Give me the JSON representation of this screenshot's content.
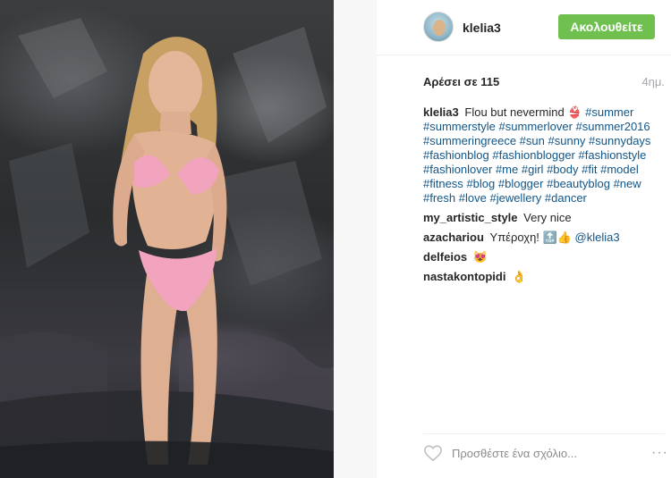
{
  "post": {
    "username": "klelia3",
    "follow_label": "Ακολουθείτε",
    "likes_label": "Αρέσει σε 115",
    "time_ago": "4ημ."
  },
  "caption": {
    "author": "klelia3",
    "text": "Flou but nevermind 👙",
    "hashtags": [
      "#summer",
      "#summerstyle",
      "#summerlover",
      "#summer2016",
      "#summeringreece",
      "#sun",
      "#sunny",
      "#sunnydays",
      "#fashionblog",
      "#fashionblogger",
      "#fashionstyle",
      "#fashionlover",
      "#me",
      "#girl",
      "#body",
      "#fit",
      "#model",
      "#fitness",
      "#blog",
      "#blogger",
      "#beautyblog",
      "#new",
      "#fresh",
      "#love",
      "#jewellery",
      "#dancer"
    ]
  },
  "comments": [
    {
      "author": "my_artistic_style",
      "text": "Very nice",
      "mention": ""
    },
    {
      "author": "azachariou",
      "text": "Υπέροχη! 🔝👍",
      "mention": "@klelia3"
    },
    {
      "author": "delfeios",
      "text": "😻",
      "mention": ""
    },
    {
      "author": "nastakontopidi",
      "text": "👌",
      "mention": ""
    }
  ],
  "footer": {
    "comment_placeholder": "Προσθέστε ένα σχόλιο...",
    "more_label": "···",
    "like_icon": "heart-outline-icon"
  },
  "colors": {
    "follow_button": "#70c050",
    "hashtag": "#125688",
    "muted": "#a5a7aa"
  }
}
